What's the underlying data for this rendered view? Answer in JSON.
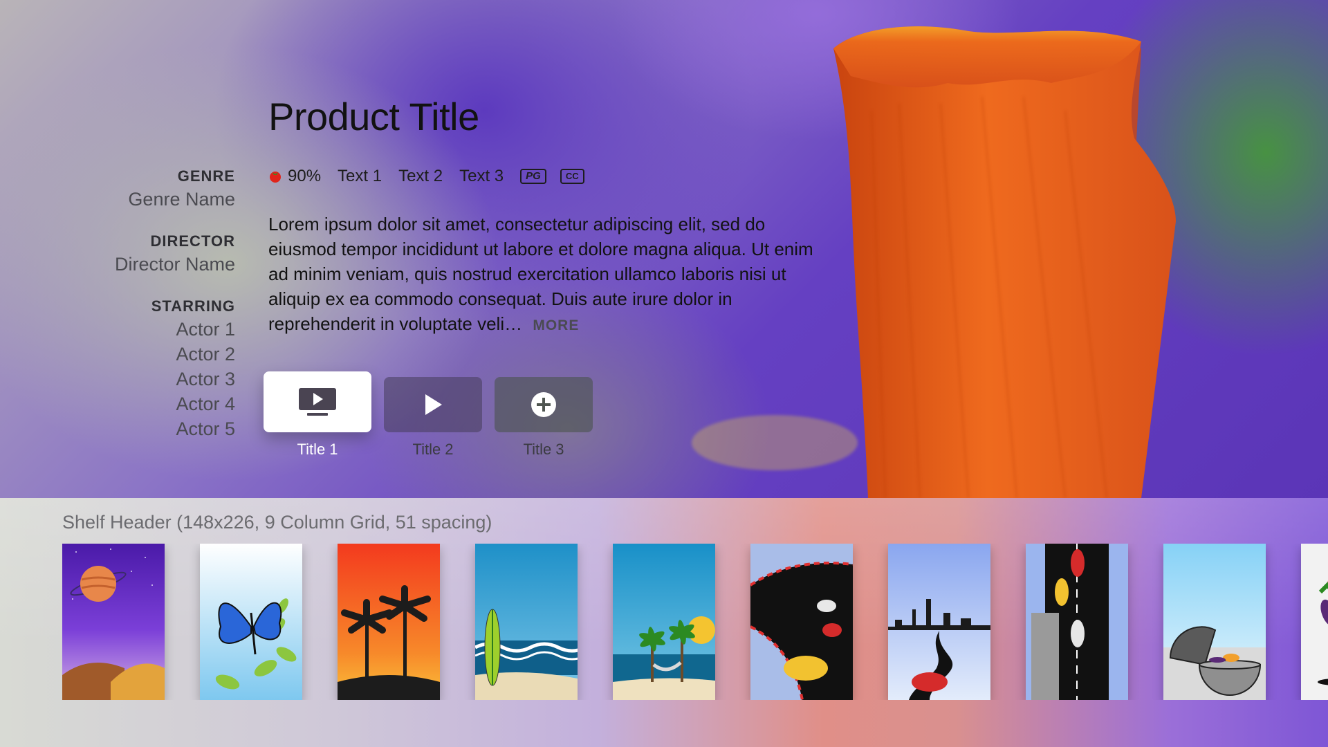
{
  "product": {
    "title": "Product Title",
    "rating_percent": "90%",
    "text1": "Text 1",
    "text2": "Text 2",
    "text3": "Text 3",
    "rating_badge": "PG",
    "cc_badge": "CC",
    "description": "Lorem ipsum dolor sit amet, consectetur adipiscing elit, sed do eiusmod tempor incididunt ut labore et dolore magna aliqua. Ut enim ad minim veniam, quis nostrud exercitation ullamco laboris nisi ut aliquip ex ea commodo consequat. Duis aute irure dolor in reprehenderit in voluptate veli…",
    "more_label": "MORE"
  },
  "meta": {
    "genre_label": "GENRE",
    "genre_value": "Genre Name",
    "director_label": "DIRECTOR",
    "director_value": "Director Name",
    "starring_label": "STARRING",
    "actors": [
      "Actor 1",
      "Actor 2",
      "Actor 3",
      "Actor 4",
      "Actor 5"
    ]
  },
  "buttons": [
    {
      "label": "Title 1",
      "icon": "tv-play-icon",
      "focused": true
    },
    {
      "label": "Title 2",
      "icon": "play-icon",
      "focused": false
    },
    {
      "label": "Title 3",
      "icon": "plus-circle-icon",
      "focused": false
    }
  ],
  "shelf": {
    "header": "Shelf Header (148x226, 9 Column Grid, 51 spacing)",
    "posters": [
      "planet-poster",
      "butterfly-poster",
      "palm-sunset-poster",
      "surfboard-beach-poster",
      "hammock-beach-poster",
      "race-track-poster",
      "city-road-poster",
      "highway-cars-poster",
      "grill-poster",
      "vegetables-poster"
    ]
  },
  "colors": {
    "focus_button": "#ffffff",
    "accent_purple": "#6540c2",
    "flower_orange": "#e8581a"
  }
}
